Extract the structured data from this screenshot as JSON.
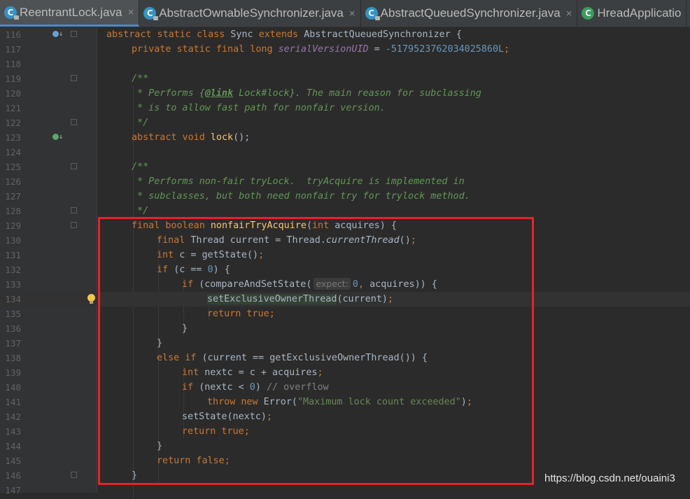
{
  "tabs": [
    {
      "label": "ReentrantLock.java",
      "close": "×",
      "active": true,
      "icon": "class-lock-icon"
    },
    {
      "label": "AbstractOwnableSynchronizer.java",
      "close": "×",
      "active": false,
      "icon": "class-lock-icon"
    },
    {
      "label": "AbstractQueuedSynchronizer.java",
      "close": "×",
      "active": false,
      "icon": "class-lock-icon"
    },
    {
      "label": "HreadApplicatio",
      "close": "",
      "active": false,
      "icon": "class-green-icon"
    }
  ],
  "line_numbers": [
    "116",
    "117",
    "118",
    "119",
    "120",
    "121",
    "122",
    "123",
    "124",
    "125",
    "126",
    "127",
    "128",
    "129",
    "130",
    "131",
    "132",
    "133",
    "134",
    "135",
    "136",
    "137",
    "138",
    "139",
    "140",
    "141",
    "142",
    "143",
    "144",
    "145",
    "146",
    "147"
  ],
  "code": {
    "l116": {
      "kw1": "abstract static class ",
      "name": "Sync ",
      "kw2": "extends ",
      "sup": "AbstractQueuedSynchronizer {"
    },
    "l117": {
      "kw": "private static final long ",
      "field": "serialVersionUID",
      "eq": " = ",
      "num": "-5179523762034025860L",
      "semi": ";"
    },
    "l119": {
      "c": "/**"
    },
    "l120": {
      "c1": " * Performs {",
      "tag": "@link",
      "c2": " Lock#lock}. The main reason for subclassing"
    },
    "l121": {
      "c": " * is to allow fast path for nonfair version."
    },
    "l122": {
      "c": " */"
    },
    "l123": {
      "kw": "abstract void ",
      "fn": "lock",
      "rest": "();"
    },
    "l125": {
      "c": "/**"
    },
    "l126": {
      "c": " * Performs non-fair tryLock.  tryAcquire is implemented in"
    },
    "l127": {
      "c": " * subclasses, but both need nonfair try for trylock method."
    },
    "l128": {
      "c": " */"
    },
    "l129": {
      "kw1": "final boolean ",
      "fn": "nonfairTryAcquire",
      "p1": "(",
      "kw2": "int ",
      "rest": "acquires) {"
    },
    "l130": {
      "kw": "final ",
      "t": "Thread current = Thread.",
      "it": "currentThread",
      "rest": "()",
      "semi": ";"
    },
    "l131": {
      "kw": "int ",
      "rest": "c = getState()",
      "semi": ";"
    },
    "l132": {
      "kw": "if ",
      "p1": "(c == ",
      "num": "0",
      "p2": ") {"
    },
    "l133": {
      "kw": "if ",
      "p1": "(compareAndSetState(",
      "hint": "expect:",
      "num": "0",
      "comma": ", ",
      "rest": "acquires)) {"
    },
    "l134": {
      "fn": "setExclusiveOwnerThread",
      "rest": "(current)",
      "semi": ";"
    },
    "l135": {
      "kw": "return true",
      "semi": ";"
    },
    "l136": {
      "t": "}"
    },
    "l137": {
      "t": "}"
    },
    "l138": {
      "kw": "else if ",
      "rest": "(current == getExclusiveOwnerThread()) {"
    },
    "l139": {
      "kw": "int ",
      "rest": "nextc = c + acquires",
      "semi": ";"
    },
    "l140": {
      "kw": "if ",
      "p1": "(nextc < ",
      "num": "0",
      "p2": ") ",
      "c": "// overflow"
    },
    "l141": {
      "kw": "throw new ",
      "t": "Error(",
      "str": "\"Maximum lock count exceeded\"",
      "rest": ")",
      "semi": ";"
    },
    "l142": {
      "t": "setState(nextc)",
      "semi": ";"
    },
    "l143": {
      "kw": "return true",
      "semi": ";"
    },
    "l144": {
      "t": "}"
    },
    "l145": {
      "kw": "return false",
      "semi": ";"
    },
    "l146": {
      "t": "}"
    }
  },
  "watermark": "https://blog.csdn.net/ouaini3"
}
